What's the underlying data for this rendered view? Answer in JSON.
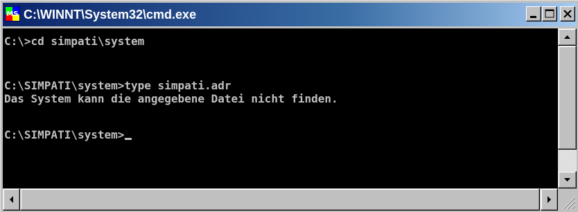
{
  "window": {
    "title": "C:\\WINNT\\System32\\cmd.exe",
    "icon": "ms-dos-icon",
    "icon_label": "MS"
  },
  "caption_buttons": {
    "minimize": "minimize-icon",
    "maximize": "maximize-icon",
    "close": "close-icon"
  },
  "console": {
    "lines": [
      "C:\\>cd simpati\\system",
      "",
      "C:\\SIMPATI\\system>type simpati.adr",
      "Das System kann die angegebene Datei nicht finden.",
      "",
      "C:\\SIMPATI\\system>"
    ],
    "colors": {
      "background": "#000000",
      "text": "#c0c0c0"
    }
  },
  "colors": {
    "titlebar_start": "#0a246a",
    "titlebar_end": "#a6caf0",
    "chrome": "#c0c0c0"
  }
}
